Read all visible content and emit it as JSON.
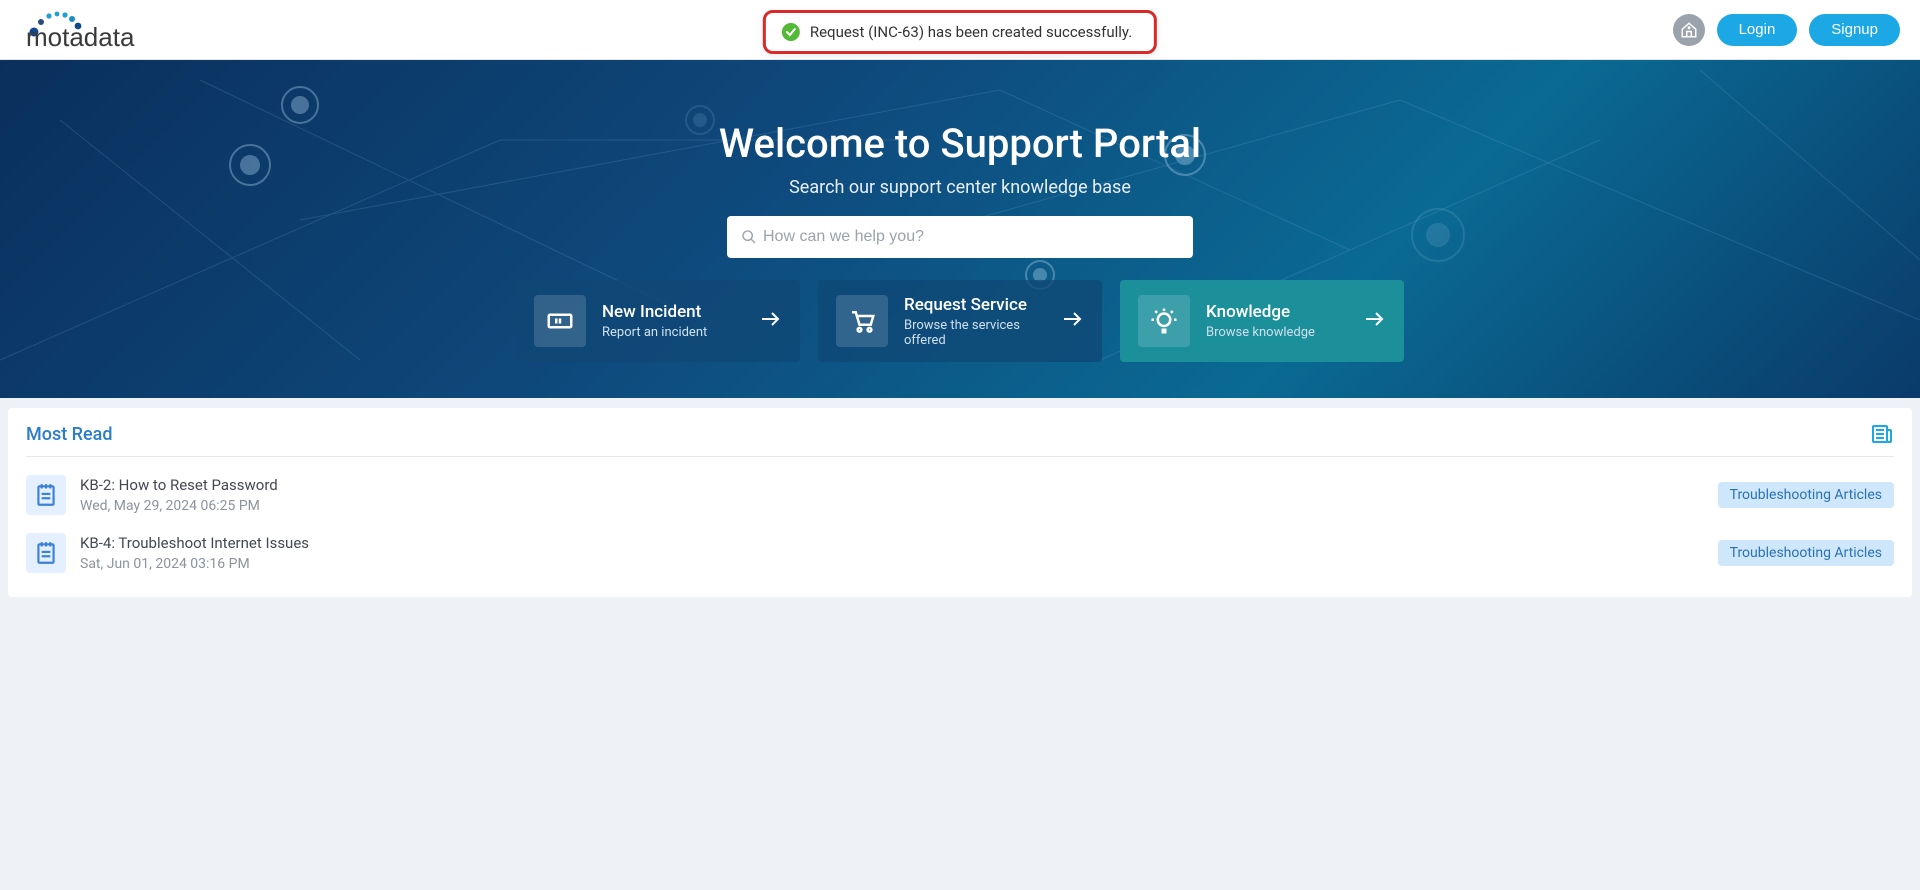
{
  "header": {
    "brand": "motadata",
    "toast": "Request (INC-63) has been created successfully.",
    "login": "Login",
    "signup": "Signup"
  },
  "hero": {
    "title": "Welcome to Support Portal",
    "subtitle": "Search our support center knowledge base",
    "search_placeholder": "How can we help you?",
    "cards": [
      {
        "title": "New Incident",
        "desc": "Report an incident"
      },
      {
        "title": "Request Service",
        "desc": "Browse the services offered"
      },
      {
        "title": "Knowledge",
        "desc": "Browse knowledge"
      }
    ]
  },
  "panel": {
    "heading": "Most Read",
    "articles": [
      {
        "title": "KB-2: How to Reset Password",
        "date": "Wed, May 29, 2024 06:25 PM",
        "tag": "Troubleshooting Articles"
      },
      {
        "title": "KB-4: Troubleshoot Internet Issues",
        "date": "Sat, Jun 01, 2024 03:16 PM",
        "tag": "Troubleshooting Articles"
      }
    ]
  },
  "colors": {
    "accent": "#1ba8e4"
  }
}
